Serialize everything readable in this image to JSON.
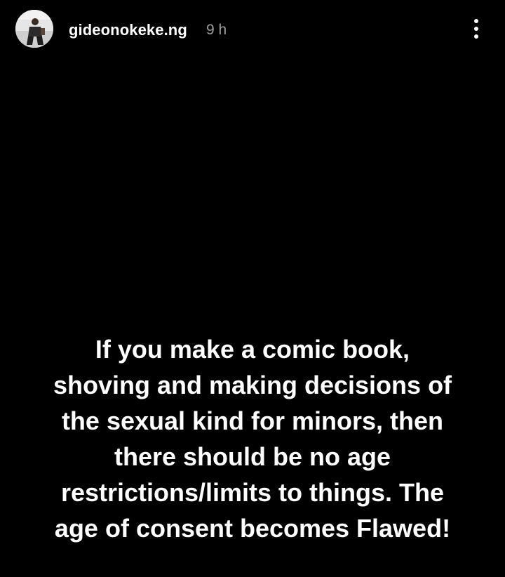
{
  "story": {
    "username": "gideonokeke.ng",
    "timestamp": "9 h",
    "more_icon": "more-vertical-icon",
    "caption_lines": [
      "If you make a comic book,",
      "shoving and making decisions of",
      "the sexual kind for minors, then",
      "there should be no age",
      "restrictions/limits to things. The",
      "age of consent becomes Flawed!"
    ]
  },
  "colors": {
    "background": "#000000",
    "text": "#ffffff",
    "timestamp": "#9e9e9e"
  }
}
